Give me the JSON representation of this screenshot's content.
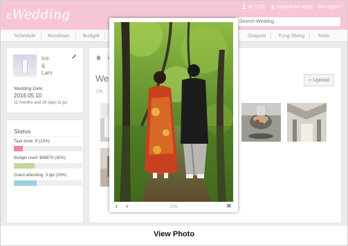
{
  "app": {
    "logo": "Wedding"
  },
  "top_bar": {
    "user_count": "W (1/0)",
    "download": "Download Apps",
    "logout": "Logout"
  },
  "search": {
    "placeholder": "Search Weddng"
  },
  "nav": {
    "items": [
      "Schedule",
      "Rundown",
      "Budget",
      "Outpost",
      "Tung Shing",
      "Tools"
    ]
  },
  "couple": {
    "name1": "Ice",
    "amp": "&",
    "name2": "Lam",
    "wedding_date_label": "Wedding Date:",
    "wedding_date": "2016.05.10",
    "countdown": "11 months and 28 days to go"
  },
  "status": {
    "title": "Status",
    "items": [
      {
        "label": "Task done: 9 (13%)",
        "percent": 13,
        "color": "#e88aa4"
      },
      {
        "label": "Budget used: $98879 (30%)",
        "percent": 30,
        "color": "#c3d79a"
      },
      {
        "label": "Guest attending: 3 ppl (33%)",
        "percent": 33,
        "color": "#9fcfdf"
      }
    ]
  },
  "main": {
    "breadcrumb_fragment": "W",
    "title_fragment": "Wed",
    "link_fragment": "Clic",
    "upload_label": "+ Upload"
  },
  "modal": {
    "prev": "‹",
    "next": "›",
    "counter": "2/6",
    "close": "✕"
  },
  "caption": "View Photo",
  "icons": {
    "user": "user-icon",
    "download": "download-icon",
    "logout": "logout-icon",
    "edit": "pencil-icon",
    "home": "home-icon",
    "prev": "chevron-left-icon",
    "next": "chevron-right-icon",
    "close": "close-icon"
  },
  "colors": {
    "header_pink": "#f7c6d4"
  }
}
